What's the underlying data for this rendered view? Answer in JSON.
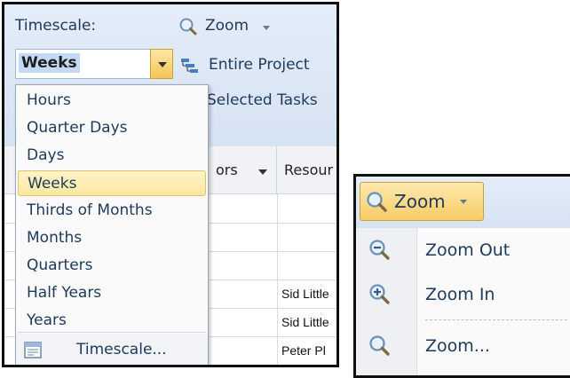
{
  "ribbon": {
    "timescale_label": "Timescale:",
    "timescale_value": "Weeks",
    "zoom_label": "Zoom",
    "entire_project_label": "Entire Project",
    "selected_tasks_label": "Selected Tasks"
  },
  "timescale_options": [
    {
      "label": "Hours",
      "selected": false
    },
    {
      "label": "Quarter Days",
      "selected": false
    },
    {
      "label": "Days",
      "selected": false
    },
    {
      "label": "Weeks",
      "selected": true
    },
    {
      "label": "Thirds of Months",
      "selected": false
    },
    {
      "label": "Months",
      "selected": false
    },
    {
      "label": "Quarters",
      "selected": false
    },
    {
      "label": "Half Years",
      "selected": false
    },
    {
      "label": "Years",
      "selected": false
    }
  ],
  "timescale_footer": {
    "label": "Timescale..."
  },
  "grid": {
    "headers": [
      "ors",
      "Resour"
    ],
    "resource_cells": [
      "Sid Little",
      "Sid Little",
      "Peter Pl"
    ]
  },
  "zoom_panel": {
    "button_label": "Zoom",
    "items": [
      {
        "label": "Zoom Out",
        "icon": "zoom-out-icon"
      },
      {
        "label": "Zoom In",
        "icon": "zoom-in-icon"
      },
      {
        "label": "Zoom...",
        "icon": "zoom-icon"
      }
    ]
  },
  "colors": {
    "accent_selected": "#fde7a0",
    "ribbon_blue": "#d6e3f3",
    "text_blue": "#1e395b"
  }
}
